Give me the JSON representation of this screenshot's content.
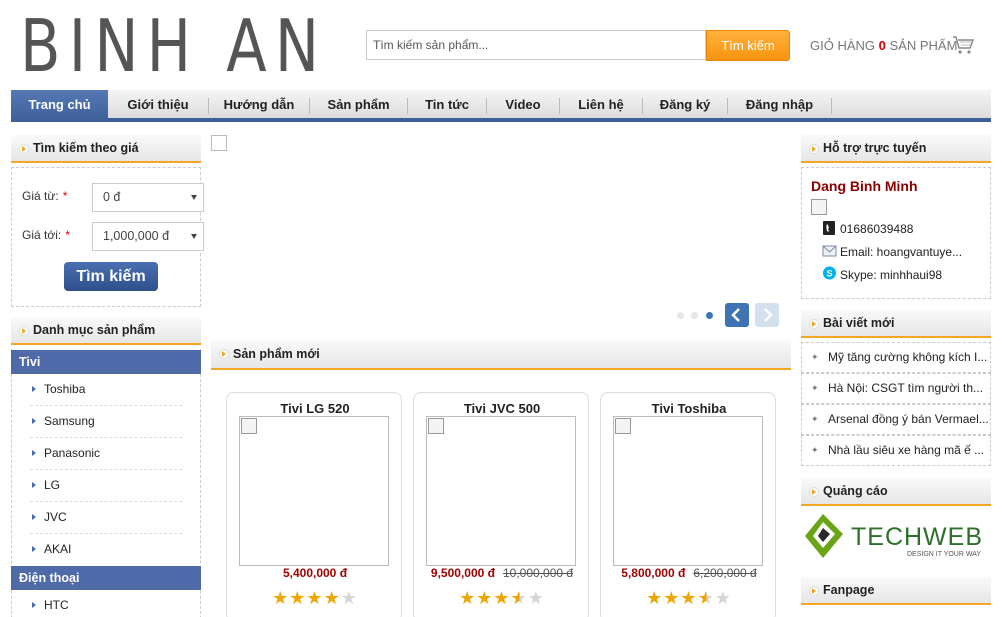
{
  "brand": {
    "logo_text": "BINH AN"
  },
  "header": {
    "search_placeholder": "Tìm kiếm sản phẩm...",
    "search_button": "Tìm kiếm",
    "cart_prefix": "GIỎ HÀNG",
    "cart_count": "0",
    "cart_suffix": "SẢN PHẨM"
  },
  "nav": {
    "items": [
      {
        "label": "Trang chủ",
        "active": true
      },
      {
        "label": "Giới thiệu"
      },
      {
        "label": "Hướng dẫn"
      },
      {
        "label": "Sản phẩm"
      },
      {
        "label": "Tin tức"
      },
      {
        "label": "Video"
      },
      {
        "label": "Liên hệ"
      },
      {
        "label": "Đăng ký"
      },
      {
        "label": "Đăng nhập"
      }
    ]
  },
  "price_filter": {
    "title": "Tìm kiếm theo giá",
    "from_label": "Giá từ:",
    "to_label": "Giá tới:",
    "required_mark": "*",
    "from_value": "0 đ",
    "to_value": "1,000,000 đ",
    "button": "Tìm kiếm"
  },
  "categories": {
    "title": "Danh mục sản phẩm",
    "groups": [
      {
        "label": "Tivi",
        "items": [
          "Toshiba",
          "Samsung",
          "Panasonic",
          "LG",
          "JVC",
          "AKAI"
        ]
      },
      {
        "label": "Điện thoại",
        "items": [
          "HTC"
        ]
      }
    ]
  },
  "new_products": {
    "title": "Sản phẩm mới",
    "products": [
      {
        "name": "Tivi LG 520",
        "price": "5,400,000 đ",
        "old_price": "",
        "rating": 4
      },
      {
        "name": "Tivi JVC 500",
        "price": "9,500,000 đ",
        "old_price": "10,000,000 đ",
        "rating": 3.5
      },
      {
        "name": "Tivi Toshiba",
        "price": "5,800,000 đ",
        "old_price": "6,200,000 đ",
        "rating": 3.5
      }
    ]
  },
  "support": {
    "title": "Hỗ trợ trực tuyến",
    "name": "Dang Binh Minh",
    "phone": "01686039488",
    "email": "Email: hoangvantuye...",
    "skype": "Skype: minhhaui98"
  },
  "news": {
    "title": "Bài viết mới",
    "items": [
      "Mỹ tăng cường không kích I...",
      "Hà Nội: CSGT tìm người th...",
      "Arsenal đồng ý bán Vermael...",
      "Nhà lầu siêu xe hàng mã ế ..."
    ]
  },
  "ads": {
    "title": "Quảng cáo",
    "brand_text": "TECHWEB",
    "tagline": "DESIGN IT YOUR WAY"
  },
  "fanpage": {
    "title": "Fanpage"
  },
  "colors": {
    "nav_active": "#3e5f99",
    "accent_orange": "#f5a623",
    "price_red": "#a10000",
    "category_blue": "#4f6aa8",
    "support_name": "#8b0000"
  }
}
